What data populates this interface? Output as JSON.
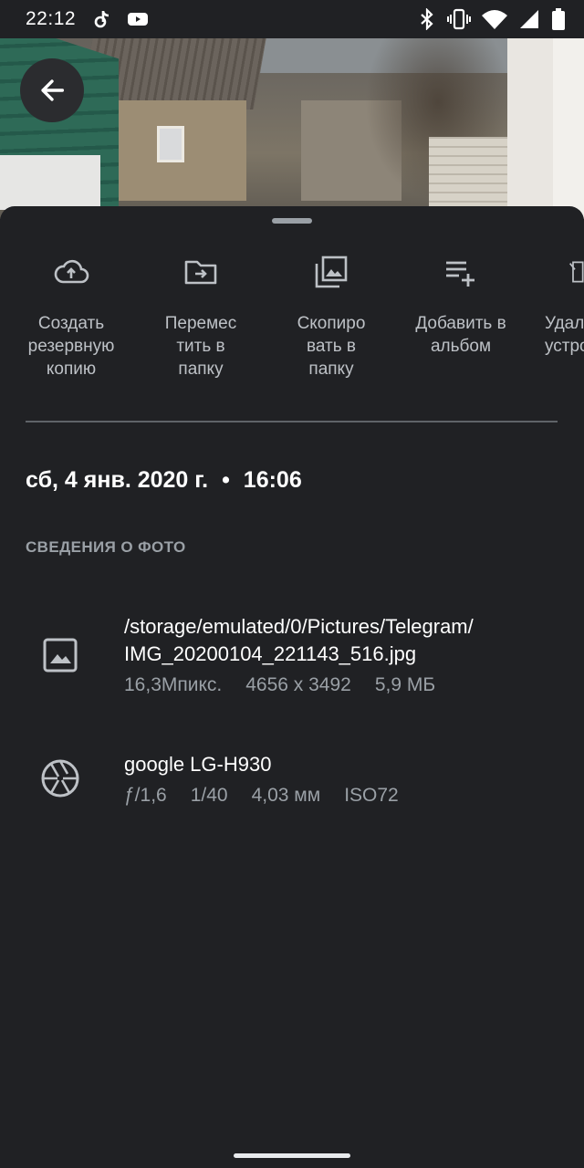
{
  "status_bar": {
    "time": "22:12",
    "left_icons": [
      "tiktok-icon",
      "youtube-icon"
    ],
    "right_icons": [
      "bluetooth-icon",
      "vibrate-icon",
      "wifi-icon",
      "signal-icon",
      "battery-icon"
    ]
  },
  "actions": [
    {
      "id": "backup",
      "icon": "cloud-upload-icon",
      "label": "Создать\nрезервную\nкопию"
    },
    {
      "id": "move",
      "icon": "folder-move-icon",
      "label": "Перемес\nтить в\nпапку"
    },
    {
      "id": "copy",
      "icon": "photo-copy-icon",
      "label": "Скопиро\nвать в\nпапку"
    },
    {
      "id": "album",
      "icon": "playlist-add-icon",
      "label": "Добавить в\nальбом"
    },
    {
      "id": "delete",
      "icon": "phone-delete-icon",
      "label": "Удал\nустро"
    }
  ],
  "details": {
    "date": "сб, 4 янв. 2020 г.",
    "separator": "•",
    "time": "16:06",
    "section_title": "СВЕДЕНИЯ О ФОТО",
    "file": {
      "path": "/storage/emulated/0/Pictures/Telegram/",
      "name": "IMG_20200104_221143_516.jpg",
      "megapixels": "16,3Мпикс.",
      "resolution": "4656 x 3492",
      "size": "5,9 МБ"
    },
    "camera": {
      "model": "google LG-H930",
      "aperture": "ƒ/1,6",
      "shutter": "1/40",
      "focal": "4,03 мм",
      "iso": "ISO72"
    }
  }
}
